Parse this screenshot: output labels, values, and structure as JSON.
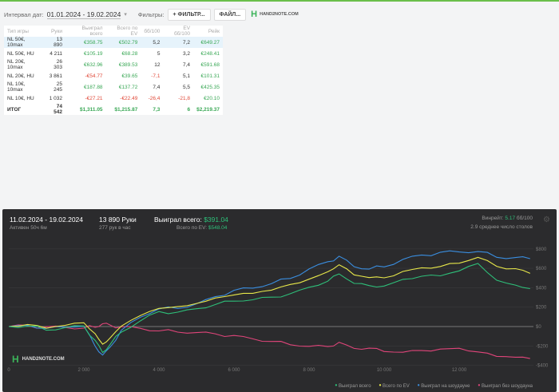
{
  "toolbar": {
    "interval_label": "Интервал дат:",
    "date_range": "01.01.2024 - 19.02.2024",
    "filters_label": "Фильтры:",
    "filter_button": "+ ФИЛЬТР...",
    "file_button": "ФАЙЛ...",
    "logo": "HAND2NOTE.COM"
  },
  "table": {
    "headers": [
      "Тип игры",
      "Руки",
      "Выиграл всего",
      "Всего по EV",
      "бб/100",
      "EV бб/100",
      "Рейк"
    ],
    "rows": [
      [
        "NL 50€, 10max",
        "13 890",
        "€358.75",
        "€502.79",
        "5,2",
        "7,2",
        "€649.27"
      ],
      [
        "NL 50€, HU",
        "4 211",
        "€105.19",
        "€68.28",
        "5",
        "3,2",
        "€248.41"
      ],
      [
        "NL 20€, 10max",
        "26 303",
        "€632.96",
        "€389.53",
        "12",
        "7,4",
        "€591.68"
      ],
      [
        "NL 20€, HU",
        "3 861",
        "-€54.77",
        "€39.65",
        "-7,1",
        "5,1",
        "€101.31"
      ],
      [
        "NL 10€, 10max",
        "25 245",
        "€187.88",
        "€137.72",
        "7,4",
        "5,5",
        "€425.35"
      ],
      [
        "NL 10€, HU",
        "1 032",
        "-€27.21",
        "-€22.49",
        "-26,4",
        "-21,8",
        "€20.10"
      ]
    ],
    "total": [
      "ИТОГ",
      "74 542",
      "$1,311.05",
      "$1,215.87",
      "7,3",
      "6",
      "$2,219.37"
    ]
  },
  "summary": {
    "dates": "11.02.2024 - 19.02.2024",
    "active": "Активен 50ч 6м",
    "hands": "13 890 Руки",
    "hands_per_hour": "277 рук в час",
    "won_label": "Выиграл всего:",
    "won": "$391.04",
    "ev_label": "Всего по EV:",
    "ev": "$548.04",
    "winrate_label": "Винрейт:",
    "winrate": "5.17",
    "winrate_unit": "бб/100",
    "tables": "2.9 среднее число столов"
  },
  "chart_data": {
    "type": "line",
    "xlim": [
      0,
      13890
    ],
    "ylim": [
      -500,
      900
    ],
    "x_ticks": [
      "0",
      "2 000",
      "4 000",
      "6 000",
      "8 000",
      "10 000",
      "12 000"
    ],
    "y_ticks": [
      "$800",
      "$600",
      "$400",
      "$200",
      "$0",
      "-$200",
      "-$400"
    ],
    "x": [
      0,
      500,
      1000,
      1500,
      2000,
      2300,
      2500,
      2700,
      3000,
      3500,
      4000,
      4500,
      5000,
      5500,
      6000,
      6500,
      7000,
      7500,
      8000,
      8500,
      8800,
      9200,
      9600,
      10000,
      10500,
      11000,
      11500,
      12000,
      12500,
      13000,
      13500,
      13890
    ],
    "series": [
      {
        "name": "Выиграл всего",
        "color": "#2ec07a",
        "values": [
          0,
          10,
          -30,
          -10,
          0,
          -150,
          -270,
          -180,
          -50,
          60,
          150,
          140,
          180,
          230,
          270,
          280,
          300,
          330,
          400,
          470,
          550,
          450,
          420,
          410,
          480,
          520,
          530,
          580,
          650,
          470,
          420,
          391
        ]
      },
      {
        "name": "Всего по EV",
        "color": "#e8e84a",
        "values": [
          0,
          20,
          -10,
          20,
          40,
          -80,
          -190,
          -120,
          10,
          120,
          190,
          200,
          230,
          290,
          330,
          350,
          380,
          430,
          480,
          560,
          640,
          540,
          510,
          500,
          560,
          600,
          620,
          660,
          720,
          620,
          590,
          548
        ]
      },
      {
        "name": "Выиграл на шоудауне",
        "color": "#3a8ee0",
        "values": [
          0,
          5,
          -20,
          0,
          10,
          -200,
          -300,
          -220,
          -40,
          100,
          190,
          190,
          230,
          300,
          370,
          400,
          450,
          500,
          590,
          660,
          720,
          620,
          600,
          620,
          690,
          730,
          760,
          770,
          780,
          720,
          710,
          700
        ]
      },
      {
        "name": "Выиграл без шоудауна",
        "color": "#e0457a",
        "values": [
          0,
          5,
          -10,
          -10,
          -10,
          0,
          30,
          10,
          -10,
          -20,
          -40,
          -50,
          -60,
          -80,
          -100,
          -130,
          -150,
          -180,
          -200,
          -210,
          -170,
          -230,
          -220,
          -250,
          -260,
          -250,
          -240,
          -230,
          -260,
          -300,
          -310,
          -330
        ]
      }
    ],
    "legend_position": "bottom-right"
  }
}
